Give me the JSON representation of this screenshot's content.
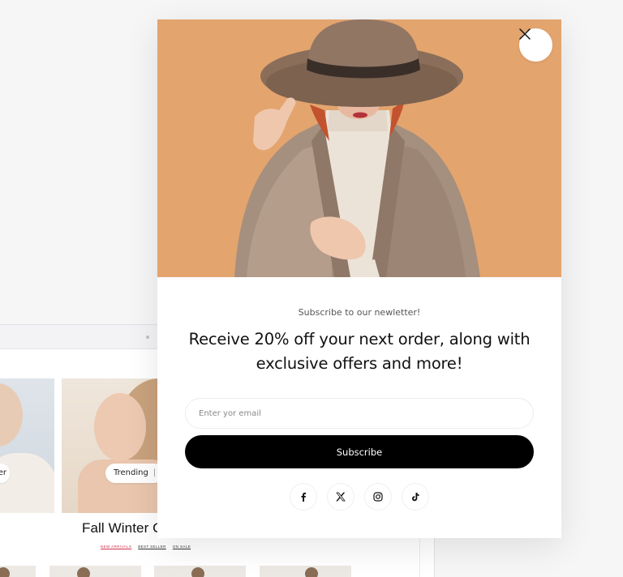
{
  "background_store": {
    "hero_tags": [
      {
        "label": "er"
      },
      {
        "label": "Trending",
        "separator": "|"
      }
    ],
    "collection_title": "Fall Winter C",
    "tabs": [
      {
        "label": "NEW ARRIVALS",
        "active": true
      },
      {
        "label": "BEST SELLER",
        "active": false
      },
      {
        "label": "ON SALE",
        "active": false
      }
    ]
  },
  "popup": {
    "eyebrow": "Subscribe to our newletter!",
    "headline": "Receive 20% off your next order, along with exclusive offers and more!",
    "email": {
      "value": "",
      "placeholder": "Enter yor email"
    },
    "subscribe_label": "Subscribe",
    "close_icon": "close-icon",
    "image_background": "#e3a46e",
    "socials": [
      {
        "icon": "facebook-icon"
      },
      {
        "icon": "x-twitter-icon"
      },
      {
        "icon": "instagram-icon"
      },
      {
        "icon": "tiktok-icon"
      }
    ]
  },
  "colors": {
    "accent": "#000000",
    "active_tab": "#d0314c",
    "page_bg": "#f6f6f7"
  }
}
